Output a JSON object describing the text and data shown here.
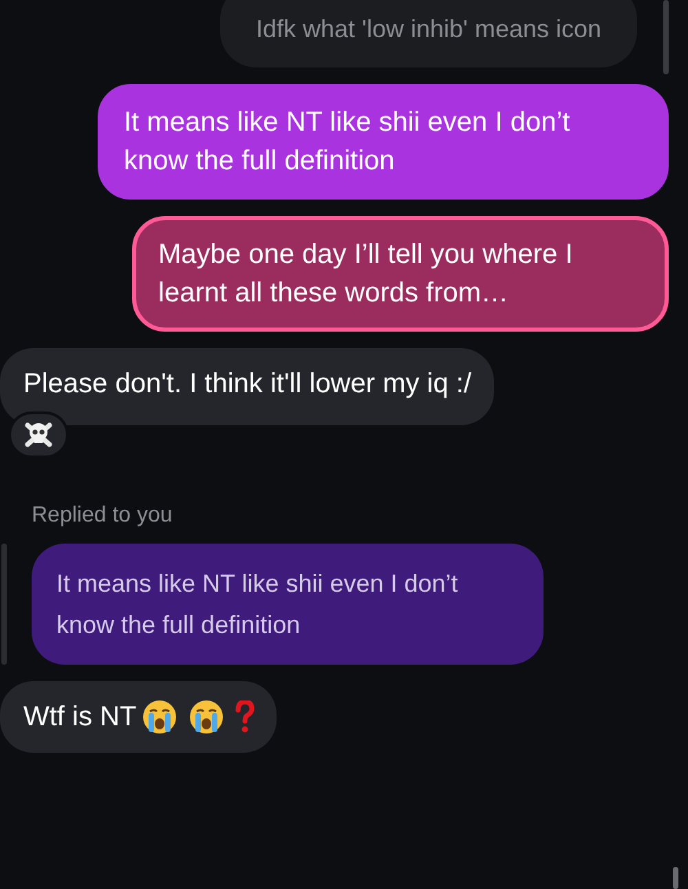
{
  "messages": [
    {
      "kind": "faded",
      "text": "Idfk what 'low inhib' means icon"
    },
    {
      "kind": "sent",
      "text": "It means like NT like shii even I don’t know the full definition",
      "highlighted": false
    },
    {
      "kind": "sent",
      "text": "Maybe one day I’ll tell you where I learnt all these words from…",
      "highlighted": true
    },
    {
      "kind": "received",
      "text": "Please don't. I think it'll lower my iq :/",
      "reacted": true
    },
    {
      "kind": "reply_label",
      "text": "Replied to you"
    },
    {
      "kind": "quoted",
      "text": "It means like NT like shii even I don’t know the full definition"
    },
    {
      "kind": "received_emoji",
      "text": "Wtf is NT",
      "reacted": false
    }
  ]
}
